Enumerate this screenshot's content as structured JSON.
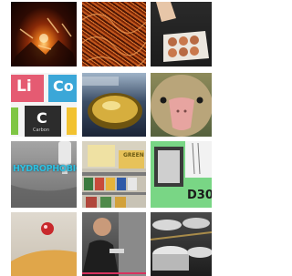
{
  "tiles": [
    {
      "topic": "fire-embers"
    },
    {
      "topic": "copper-tangle"
    },
    {
      "topic": "egg-carton"
    },
    {
      "topic": "periodic-elements",
      "symbols": [
        "Li",
        "Co",
        "C"
      ],
      "caption": "Carbon"
    },
    {
      "topic": "brass-dish"
    },
    {
      "topic": "duck-face"
    },
    {
      "topic": "hydrophobic-spray",
      "text": "HYDROPHOBIC"
    },
    {
      "topic": "store-shelf",
      "sign": "GREEN"
    },
    {
      "topic": "d30-material",
      "text": "D30"
    },
    {
      "topic": "glass-ball-on-wood"
    },
    {
      "topic": "man-with-tool"
    },
    {
      "topic": "drum-kit"
    }
  ],
  "colors": {
    "lithium_tile": "#e55b72",
    "cobalt_tile": "#3ba7d8",
    "carbon_tile": "#2c2c2c",
    "hydrophobic_text": "#30c0e0",
    "d30_bg": "#79d685"
  }
}
